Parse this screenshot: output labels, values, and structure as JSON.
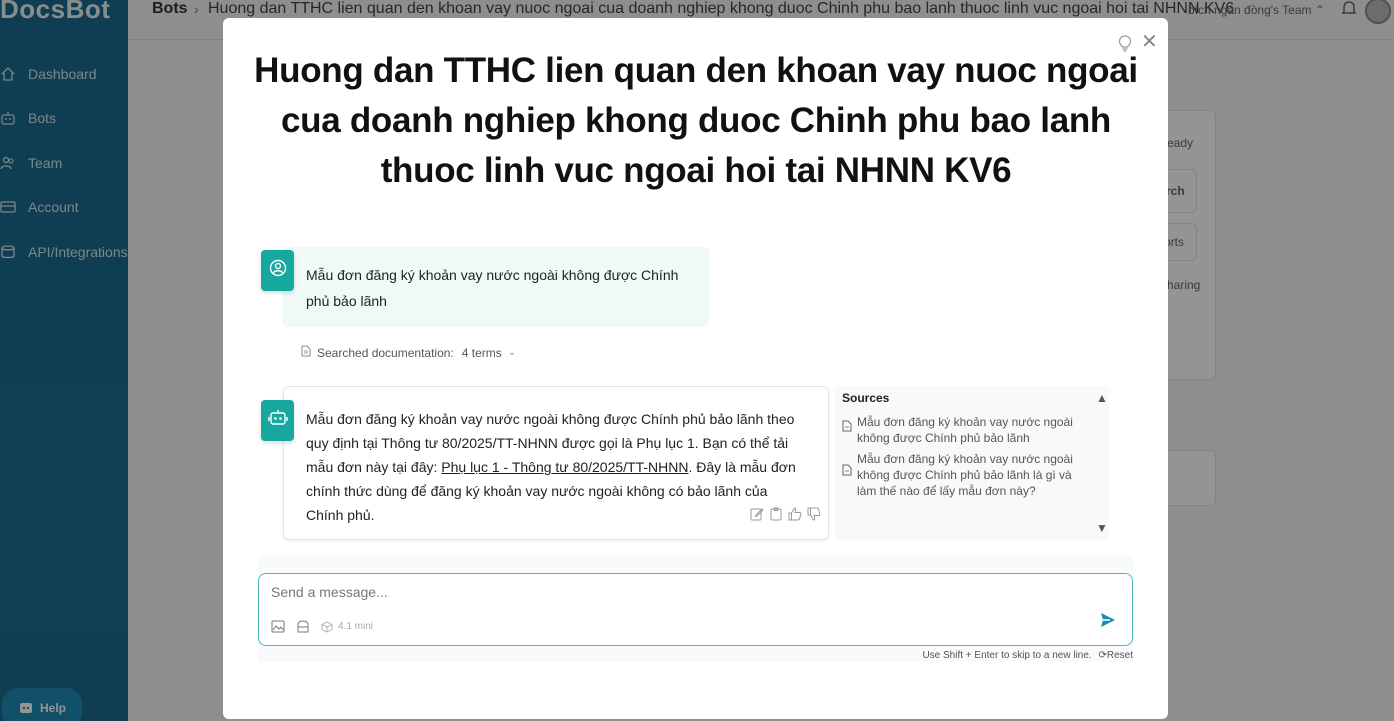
{
  "app": {
    "logo": "DocsBot",
    "sidebar": [
      {
        "label": "Dashboard",
        "icon": "home-icon"
      },
      {
        "label": "Bots",
        "icon": "robot-icon"
      },
      {
        "label": "Team",
        "icon": "team-icon"
      },
      {
        "label": "Account",
        "icon": "card-icon"
      },
      {
        "label": "API/Integrations",
        "icon": "integrations-icon"
      }
    ],
    "help_label": "Help",
    "breadcrumb_root": "Bots",
    "breadcrumb_title": "Huong dan TTHC lien quan den khoan vay nuoc ngoai cua doanh nghiep khong duoc Chinh phu bao lanh thuoc linh vuc ngoai hoi tai NHNN KV6",
    "team_selector": "bích ngân đồng's Team ⌃",
    "bg_fragments": [
      "eady",
      "rch",
      "orts",
      "haring"
    ]
  },
  "modal": {
    "title": "Huong dan TTHC lien quan den khoan vay nuoc ngoai cua doanh nghiep khong duoc Chinh phu bao lanh thuoc linh vuc ngoai hoi tai NHNN KV6",
    "user_message": "Mẫu đơn đăng ký khoản vay nước ngoài không được Chính phủ bảo lãnh",
    "searched_label": "Searched documentation:",
    "searched_terms": "4 terms",
    "bot_message": {
      "before_link": "Mẫu đơn đăng ký khoản vay nước ngoài không được Chính phủ bảo lãnh theo quy định tại Thông tư 80/2025/TT-NHNN được gọi là Phụ lục 1. Bạn có thể tải mẫu đơn này tại đây: ",
      "link": "Phụ lục 1 - Thông tư 80/2025/TT-NHNN",
      "after_link": ". Đây là mẫu đơn chính thức dùng để đăng ký khoản vay nước ngoài không có bảo lãnh của Chính phủ."
    },
    "sources_title": "Sources",
    "sources": [
      "Mẫu đơn đăng ký khoản vay nước ngoài không được Chính phủ bảo lãnh",
      "Mẫu đơn đăng ký khoản vay nước ngoài không được Chính phủ bảo lãnh là gì và làm thế nào để lấy mẫu đơn này?"
    ],
    "composer_placeholder": "Send a message...",
    "model_label": "4.1 mini",
    "hint_text": "Use Shift + Enter to skip to a new line.",
    "reset_label": "Reset"
  },
  "colors": {
    "sidebar": "#1b6c8d",
    "accent": "#17a8a0",
    "composer_border": "#4db6c4",
    "send": "#1f8ab5"
  }
}
